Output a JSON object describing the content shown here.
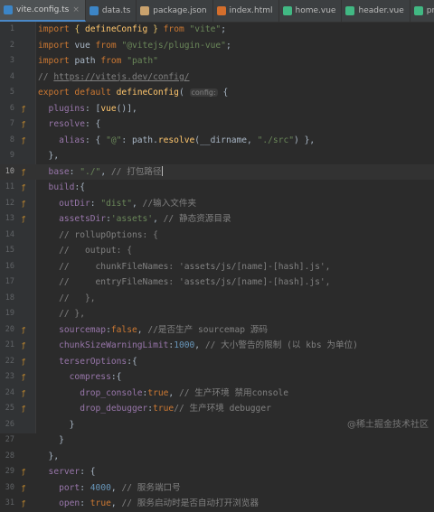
{
  "tabs": [
    {
      "label": "vite.config.ts",
      "active": true,
      "icon": "ts-icon",
      "color": "#3c85c6"
    },
    {
      "label": "data.ts",
      "active": false,
      "icon": "ts-icon",
      "color": "#3c85c6"
    },
    {
      "label": "package.json",
      "active": false,
      "icon": "json-icon",
      "color": "#c9a26d"
    },
    {
      "label": "index.html",
      "active": false,
      "icon": "html-icon",
      "color": "#d46e2c"
    },
    {
      "label": "home.vue",
      "active": false,
      "icon": "vue-icon",
      "color": "#41b883"
    },
    {
      "label": "header.vue",
      "active": false,
      "icon": "vue-icon",
      "color": "#41b883"
    },
    {
      "label": "primarytitle.vue",
      "active": false,
      "icon": "vue-icon",
      "color": "#41b883"
    }
  ],
  "current_line": "10",
  "watermark": "@稀土掘金技术社区",
  "lines": [
    {
      "n": "1",
      "m": "",
      "parts": [
        [
          "k",
          "import "
        ],
        [
          "br",
          "{ "
        ],
        [
          "f",
          "defineConfig"
        ],
        [
          "br",
          " }"
        ],
        [
          "k",
          " from "
        ],
        [
          "s",
          "\"vite\""
        ],
        [
          "t",
          ";"
        ]
      ]
    },
    {
      "n": "2",
      "m": "",
      "parts": [
        [
          "k",
          "import "
        ],
        [
          "t",
          "vue "
        ],
        [
          "k",
          "from "
        ],
        [
          "s",
          "\"@vitejs/plugin-vue\""
        ],
        [
          "t",
          ";"
        ]
      ]
    },
    {
      "n": "3",
      "m": "",
      "parts": [
        [
          "k",
          "import "
        ],
        [
          "t",
          "path "
        ],
        [
          "k",
          "from "
        ],
        [
          "s",
          "\"path\""
        ]
      ]
    },
    {
      "n": "4",
      "m": "",
      "parts": [
        [
          "c",
          "// "
        ],
        [
          "u",
          "https://vitejs.dev/config/"
        ]
      ]
    },
    {
      "n": "5",
      "m": "",
      "parts": [
        [
          "k",
          "export default "
        ],
        [
          "f",
          "defineConfig"
        ],
        [
          "t",
          "( "
        ],
        [
          "h",
          "config:"
        ],
        [
          "t",
          " {"
        ]
      ]
    },
    {
      "n": "6",
      "m": "ƒ",
      "parts": [
        [
          "p",
          "  plugins"
        ],
        [
          "t",
          ": ["
        ],
        [
          "f",
          "vue"
        ],
        [
          "t",
          "()],"
        ]
      ]
    },
    {
      "n": "7",
      "m": "ƒ",
      "parts": [
        [
          "p",
          "  resolve"
        ],
        [
          "t",
          ": {"
        ]
      ]
    },
    {
      "n": "8",
      "m": "ƒ",
      "parts": [
        [
          "p",
          "    alias"
        ],
        [
          "t",
          ": { "
        ],
        [
          "s",
          "\"@\""
        ],
        [
          "t",
          ": path."
        ],
        [
          "f",
          "resolve"
        ],
        [
          "t",
          "(__dirname, "
        ],
        [
          "s",
          "\"./src\""
        ],
        [
          "t",
          ") },"
        ]
      ]
    },
    {
      "n": "9",
      "m": "",
      "parts": [
        [
          "t",
          "  },"
        ]
      ]
    },
    {
      "n": "10",
      "m": "ƒ",
      "parts": [
        [
          "p",
          "  base"
        ],
        [
          "t",
          ": "
        ],
        [
          "s",
          "\"./\""
        ],
        [
          "t",
          ", "
        ],
        [
          "c",
          "// 打包路径"
        ],
        [
          "caret",
          ""
        ]
      ]
    },
    {
      "n": "11",
      "m": "ƒ",
      "parts": [
        [
          "p",
          "  build"
        ],
        [
          "t",
          ":{"
        ]
      ]
    },
    {
      "n": "12",
      "m": "ƒ",
      "parts": [
        [
          "p",
          "    outDir"
        ],
        [
          "t",
          ": "
        ],
        [
          "s",
          "\"dist\""
        ],
        [
          "t",
          ", "
        ],
        [
          "c",
          "//输入文件夹"
        ]
      ]
    },
    {
      "n": "13",
      "m": "ƒ",
      "parts": [
        [
          "p",
          "    assetsDir"
        ],
        [
          "t",
          ":"
        ],
        [
          "s",
          "'assets'"
        ],
        [
          "t",
          ", "
        ],
        [
          "c",
          "// 静态资源目录"
        ]
      ]
    },
    {
      "n": "14",
      "m": "",
      "parts": [
        [
          "c",
          "    // rollupOptions: {"
        ]
      ]
    },
    {
      "n": "15",
      "m": "",
      "parts": [
        [
          "c",
          "    //   output: {"
        ]
      ]
    },
    {
      "n": "16",
      "m": "",
      "parts": [
        [
          "c",
          "    //     chunkFileNames: 'assets/js/[name]-[hash].js',"
        ]
      ]
    },
    {
      "n": "17",
      "m": "",
      "parts": [
        [
          "c",
          "    //     entryFileNames: 'assets/js/[name]-[hash].js',"
        ]
      ]
    },
    {
      "n": "18",
      "m": "",
      "parts": [
        [
          "c",
          "    //   },"
        ]
      ]
    },
    {
      "n": "19",
      "m": "",
      "parts": [
        [
          "c",
          "    // },"
        ]
      ]
    },
    {
      "n": "20",
      "m": "ƒ",
      "parts": [
        [
          "p",
          "    sourcemap"
        ],
        [
          "t",
          ":"
        ],
        [
          "k",
          "false"
        ],
        [
          "t",
          ", "
        ],
        [
          "c",
          "//是否生产 sourcemap 源码"
        ]
      ]
    },
    {
      "n": "21",
      "m": "ƒ",
      "parts": [
        [
          "p",
          "    chunkSizeWarningLimit"
        ],
        [
          "t",
          ":"
        ],
        [
          "n",
          "1000"
        ],
        [
          "t",
          ", "
        ],
        [
          "c",
          "// 大小警告的限制 (以 kbs 为单位)"
        ]
      ]
    },
    {
      "n": "22",
      "m": "ƒ",
      "parts": [
        [
          "p",
          "    terserOptions"
        ],
        [
          "t",
          ":{"
        ]
      ]
    },
    {
      "n": "23",
      "m": "ƒ",
      "parts": [
        [
          "p",
          "      compress"
        ],
        [
          "t",
          ":{"
        ]
      ]
    },
    {
      "n": "24",
      "m": "ƒ",
      "parts": [
        [
          "p",
          "        drop_console"
        ],
        [
          "t",
          ":"
        ],
        [
          "k",
          "true"
        ],
        [
          "t",
          ", "
        ],
        [
          "c",
          "// 生产环境 禁用console"
        ]
      ]
    },
    {
      "n": "25",
      "m": "ƒ",
      "parts": [
        [
          "p",
          "        drop_debugger"
        ],
        [
          "t",
          ":"
        ],
        [
          "k",
          "true"
        ],
        [
          "c",
          "// 生产环境 debugger"
        ]
      ]
    },
    {
      "n": "26",
      "m": "",
      "parts": [
        [
          "t",
          "      }"
        ]
      ]
    },
    {
      "n": "27",
      "m": "",
      "parts": [
        [
          "t",
          "    }"
        ]
      ]
    },
    {
      "n": "28",
      "m": "",
      "parts": [
        [
          "t",
          "  },"
        ]
      ]
    },
    {
      "n": "29",
      "m": "ƒ",
      "parts": [
        [
          "p",
          "  server"
        ],
        [
          "t",
          ": {"
        ]
      ]
    },
    {
      "n": "30",
      "m": "ƒ",
      "parts": [
        [
          "p",
          "    port"
        ],
        [
          "t",
          ": "
        ],
        [
          "n",
          "4000"
        ],
        [
          "t",
          ", "
        ],
        [
          "c",
          "// 服务端口号"
        ]
      ]
    },
    {
      "n": "31",
      "m": "ƒ",
      "parts": [
        [
          "p",
          "    open"
        ],
        [
          "t",
          ": "
        ],
        [
          "k",
          "true"
        ],
        [
          "t",
          ", "
        ],
        [
          "c",
          "// 服务启动时是否自动打开浏览器"
        ]
      ]
    }
  ]
}
